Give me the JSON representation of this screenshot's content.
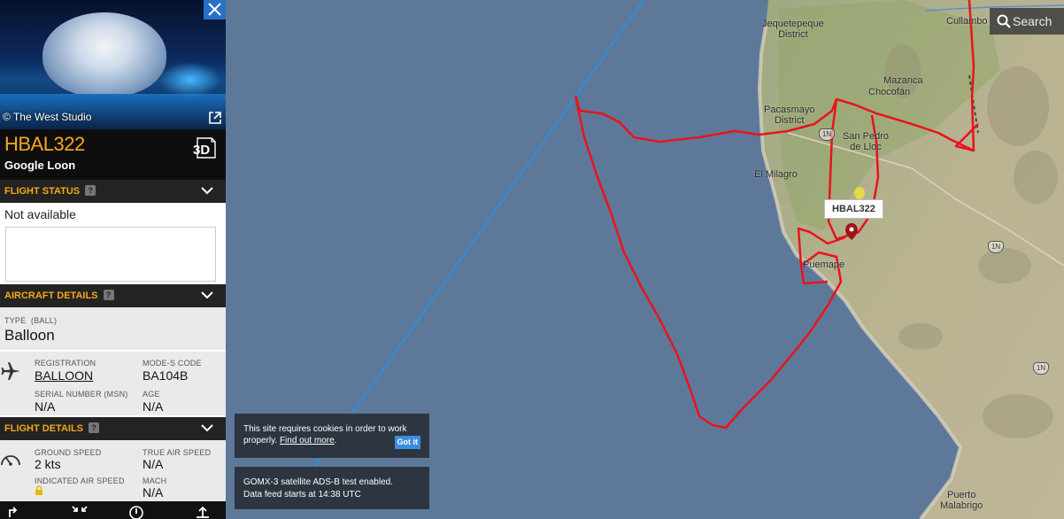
{
  "map": {
    "places": [
      {
        "id": "jequetepeque",
        "label": "Jequetepeque\nDistrict"
      },
      {
        "id": "cullambo",
        "label": "Cullambo"
      },
      {
        "id": "mazanca",
        "label": "Mazanca"
      },
      {
        "id": "chocofan",
        "label": "Chocofán"
      },
      {
        "id": "pacasmayo",
        "label": "Pacasmayo\nDistrict"
      },
      {
        "id": "san-pedro",
        "label": "San Pedro\nde Lloc"
      },
      {
        "id": "el-milagro",
        "label": "El Milagro"
      },
      {
        "id": "puemape",
        "label": "Puemape"
      },
      {
        "id": "puerto-malabrigo",
        "label": "Puerto\nMalabrigo"
      }
    ],
    "road_shields": [
      "1N",
      "1N",
      "1N"
    ],
    "flight_tag": "HBAL322",
    "colors": {
      "sea": "#5e7899",
      "land": "#b7b08f",
      "track": "#e8141b",
      "route": "#2b8fe0"
    }
  },
  "search": {
    "label": "Search",
    "icon": "search-icon"
  },
  "cookie": {
    "text": "This site requires cookies in order to work properly.",
    "link": "Find out more",
    "suffix": ".",
    "button": "Got it"
  },
  "notice": {
    "line1": "GOMX-3 satellite ADS-B test enabled.",
    "line2": "Data feed starts at 14:38 UTC"
  },
  "panel": {
    "photo_credit": "© The West Studio",
    "callsign": "HBAL322",
    "airline": "Google Loon",
    "btn_3d": "3D",
    "sections": {
      "flight_status": "FLIGHT STATUS",
      "aircraft_details": "AIRCRAFT DETAILS",
      "flight_details": "FLIGHT DETAILS"
    },
    "status": "Not available",
    "aircraft": {
      "type_label": "TYPE",
      "type_code": "(BALL)",
      "type_value": "Balloon",
      "registration_label": "REGISTRATION",
      "registration": "BALLOON",
      "modes_label": "MODE-S CODE",
      "modes": "BA104B",
      "serial_label": "SERIAL NUMBER (MSN)",
      "serial": "N/A",
      "age_label": "AGE",
      "age": "N/A"
    },
    "flight": {
      "gs_label": "GROUND SPEED",
      "gs": "2 kts",
      "tas_label": "TRUE AIR SPEED",
      "tas": "N/A",
      "ias_label": "INDICATED AIR SPEED",
      "mach_label": "MACH",
      "mach": "N/A"
    }
  }
}
